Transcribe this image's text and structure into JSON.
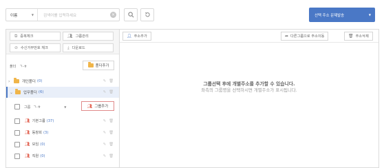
{
  "search": {
    "field_label": "이름",
    "placeholder": "검색어를 입력하세요"
  },
  "send_button": "선택 주소 문제발송",
  "left": {
    "buttons": [
      "중복체크",
      "그룹관리",
      "수신거부번호 체크",
      "다운로드"
    ],
    "sort_label": "폴더",
    "sort_value": "ㄱ-ㅎ",
    "folder_add": "폴더추가",
    "folders": [
      {
        "name": "개인폴더",
        "count": "(0)"
      },
      {
        "name": "업무폴더",
        "count": "(6)"
      }
    ],
    "group_sort_label": "그룹",
    "group_sort_value": "ㄱ-ㅎ",
    "group_add": "그룹추가",
    "groups": [
      {
        "name": "기본그룹",
        "count": "(37)"
      },
      {
        "name": "동창회",
        "count": "(3)"
      },
      {
        "name": "모임",
        "count": "(0)"
      },
      {
        "name": "직원",
        "count": "(0)"
      }
    ]
  },
  "right": {
    "add_address": "주소추가",
    "move_group": "다른그룹으로 주소이동",
    "delete_address": "주소삭제",
    "empty_title": "그룹선택 후에 개별주소를 추가할 수 있습니다.",
    "empty_desc": "좌측의 그룹명을 선택하시면 개별주소가 표시됩니다."
  },
  "colors": {
    "accent": "#4a78c6",
    "folder": "#f0b54a",
    "group_icon": "#e36b5b"
  }
}
